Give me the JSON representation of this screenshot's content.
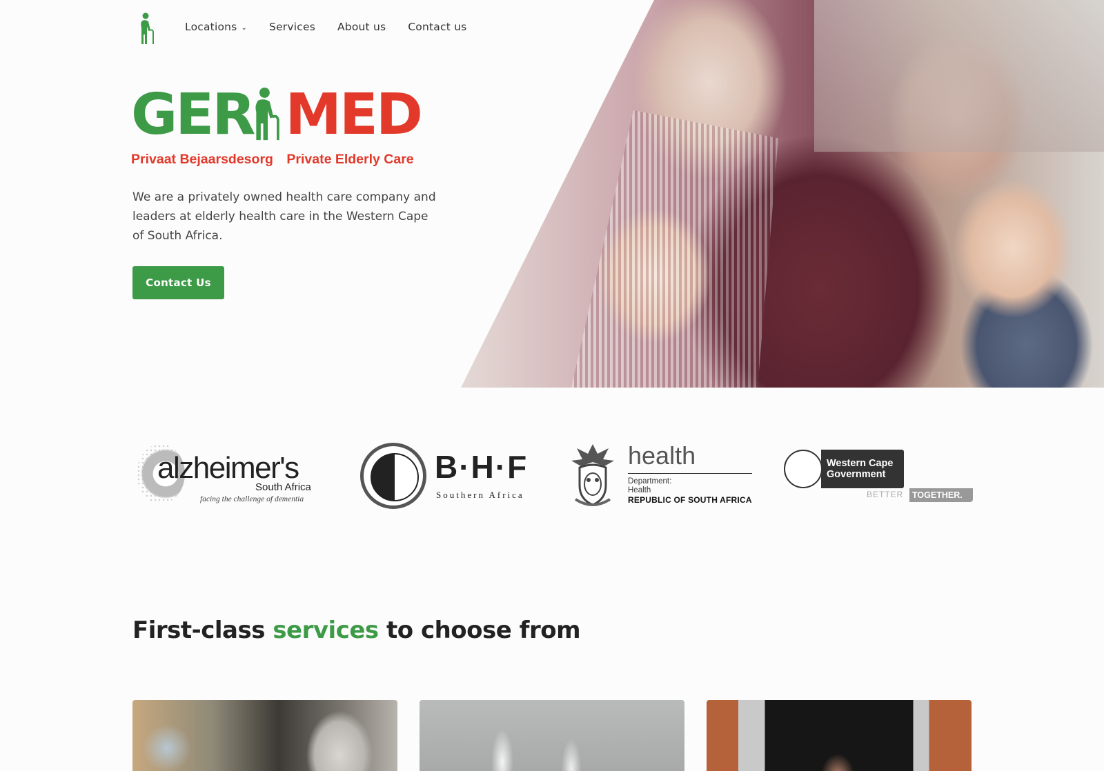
{
  "nav": {
    "items": [
      {
        "label": "Locations",
        "has_dropdown": true
      },
      {
        "label": "Services",
        "has_dropdown": false
      },
      {
        "label": "About us",
        "has_dropdown": false
      },
      {
        "label": "Contact us",
        "has_dropdown": false
      }
    ]
  },
  "brand": {
    "word_left": "GER",
    "word_right": "MED",
    "tagline_afrikaans": "Privaat Bejaarsdesorg",
    "tagline_english": "Private Elderly Care"
  },
  "hero": {
    "description": "We are a privately owned health care company and leaders at elderly health care in the Western Cape of South Africa.",
    "cta_label": "Contact Us"
  },
  "partners": {
    "alzheimers": {
      "word": "alzheimer's",
      "region": "South Africa",
      "tagline": "facing the challenge of dementia"
    },
    "bhf": {
      "letters": "B·H·F",
      "sub": "Southern Africa"
    },
    "health": {
      "word": "health",
      "dept_line1": "Department:",
      "dept_line2": "Health",
      "country": "REPUBLIC OF SOUTH AFRICA"
    },
    "wcg": {
      "line1": "Western Cape",
      "line2": "Government",
      "better": "BETTER",
      "together": "TOGETHER."
    }
  },
  "services": {
    "title_before": "First-class ",
    "title_accent": "services",
    "title_after": " to choose from"
  },
  "colors": {
    "brand_green": "#3d9b47",
    "brand_red": "#e2392b",
    "text": "#333333"
  },
  "icons": [
    "elderly-person-logo-icon",
    "chevron-down-icon"
  ]
}
